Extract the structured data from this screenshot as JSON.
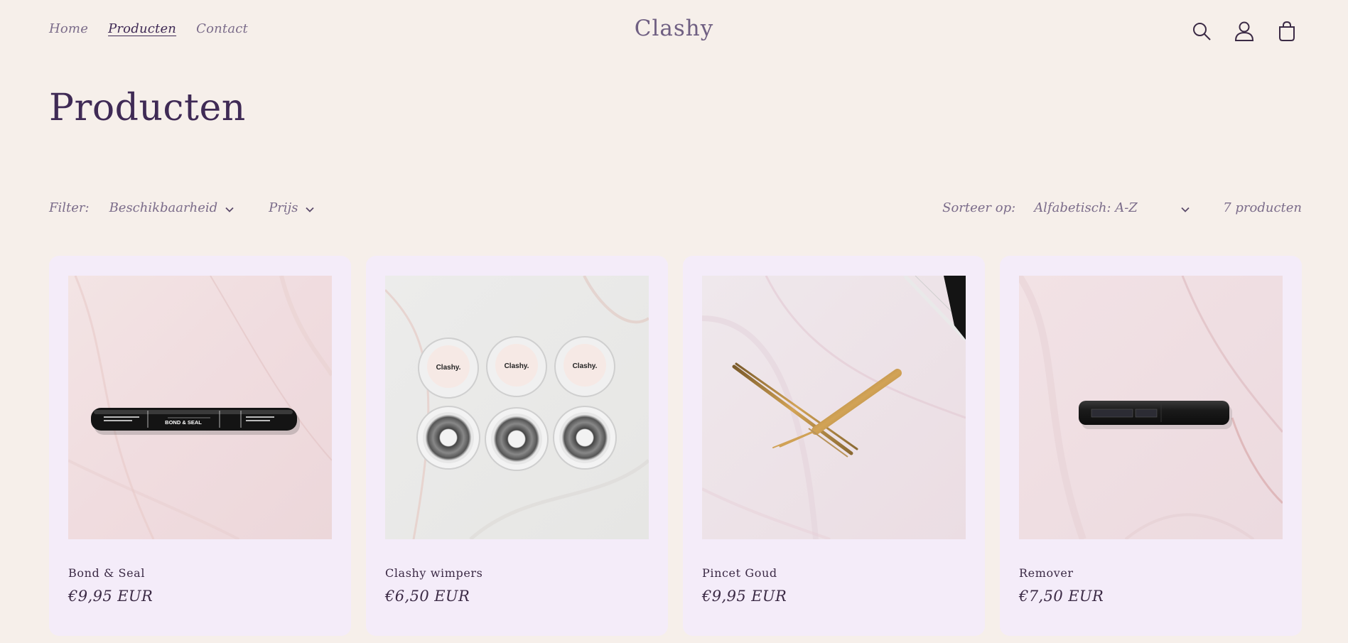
{
  "header": {
    "nav": [
      {
        "label": "Home"
      },
      {
        "label": "Producten"
      },
      {
        "label": "Contact"
      }
    ],
    "logo": "Clashy"
  },
  "page": {
    "title": "Producten"
  },
  "filters": {
    "label": "Filter:",
    "availability": "Beschikbaarheid",
    "price": "Prijs",
    "sort_label": "Sorteer op:",
    "sort_value": "Alfabetisch: A-Z",
    "count": "7 producten"
  },
  "products": [
    {
      "name": "Bond & Seal",
      "price": "€9,95 EUR"
    },
    {
      "name": "Clashy wimpers",
      "price": "€6,50 EUR"
    },
    {
      "name": "Pincet Goud",
      "price": "€9,95 EUR"
    },
    {
      "name": "Remover",
      "price": "€7,50 EUR"
    }
  ],
  "product_images": {
    "bond_seal_tube": "BOND & SEAL",
    "lash_cap": "Clashy."
  }
}
